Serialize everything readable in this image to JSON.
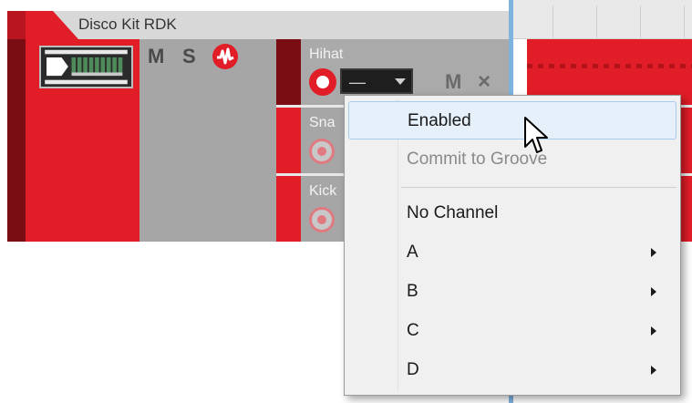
{
  "track": {
    "title": "Disco Kit RDK",
    "collapse_icon": "triangle-down-icon",
    "device_icon": "drum-machine-icon",
    "mute_label": "M",
    "solo_label": "S",
    "record_icon": "waveform-record-icon"
  },
  "lanes": [
    {
      "name": "Hihat",
      "channel_value": "—",
      "mute_label": "M",
      "delete_label": "×"
    },
    {
      "name": "Sna"
    },
    {
      "name": "Kick"
    }
  ],
  "context_menu": {
    "items": [
      {
        "label": "Enabled",
        "state": "hover"
      },
      {
        "label": "Commit to Groove",
        "state": "disabled"
      },
      {
        "label": "No Channel"
      },
      {
        "label": "A",
        "submenu": true
      },
      {
        "label": "B",
        "submenu": true
      },
      {
        "label": "C",
        "submenu": true
      },
      {
        "label": "D",
        "submenu": true
      }
    ]
  },
  "colors": {
    "accent_red": "#e11d27",
    "dark_red": "#7a0c14",
    "panel_gray": "#a6a6a6",
    "menu_hover": "#e5f0fb",
    "playhead_blue": "#7fb2de"
  }
}
